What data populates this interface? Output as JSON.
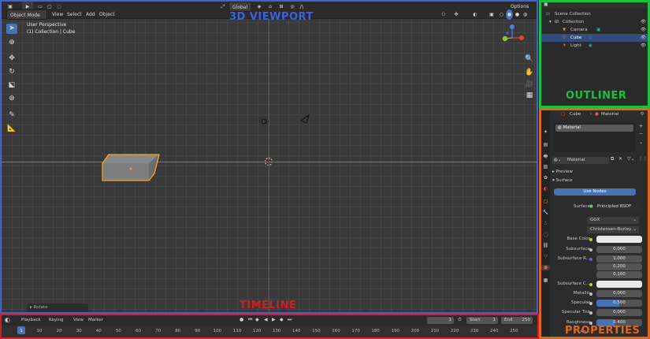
{
  "viewport": {
    "overlay_title": "3D VIEWPORT",
    "mode": "Object Mode",
    "menus": [
      "View",
      "Select",
      "Add",
      "Object"
    ],
    "orientation": "Global",
    "options_label": "Options",
    "perspective": "User Perspective",
    "context": "(1) Collection | Cube",
    "last_operator": "Rotate",
    "colors": {
      "x_axis": "#e2443d",
      "y_axis": "#8ac248",
      "z_axis": "#4a7fe0",
      "selection": "#f5a623"
    }
  },
  "outliner": {
    "overlay_title": "OUTLINER",
    "root": "Scene Collection",
    "items": [
      {
        "label": "Collection"
      },
      {
        "label": "Camera"
      },
      {
        "label": "Cube"
      },
      {
        "label": "Light"
      }
    ]
  },
  "properties": {
    "overlay_title": "PROPERTIES",
    "breadcrumb_object": "Cube",
    "breadcrumb_material": "Material",
    "slot_name": "Material",
    "material_name": "Material",
    "panels": {
      "preview": "Preview",
      "surface": "Surface"
    },
    "use_nodes": "Use Nodes",
    "surface_label": "Surface",
    "surface_value": "Principled BSDF",
    "distribution": "GGX",
    "subsurface_method": "Christensen-Burley",
    "fields": {
      "base_color": "Base Color",
      "subsurface": "Subsurface",
      "subsurface_value": "0.000",
      "subsurface_radius": "Subsurface R...",
      "radius_1": "1.000",
      "radius_2": "0.200",
      "radius_3": "0.100",
      "subsurface_color": "Subsurface C...",
      "metallic": "Metallic",
      "metallic_value": "0.000",
      "specular": "Specular",
      "specular_value": "0.500",
      "specular_tint": "Specular Tint",
      "specular_tint_value": "0.000",
      "roughness": "Roughness",
      "roughness_value": "0.400",
      "anisotropic": "An..."
    }
  },
  "timeline": {
    "overlay_title": "TIMELINE",
    "menus": [
      "Playback",
      "Keying",
      "View",
      "Marker"
    ],
    "current_frame": "1",
    "start_label": "Start",
    "start_value": "1",
    "end_label": "End",
    "end_value": "250",
    "ticks": [
      "1",
      "10",
      "20",
      "30",
      "40",
      "50",
      "60",
      "70",
      "80",
      "90",
      "100",
      "110",
      "120",
      "130",
      "140",
      "150",
      "160",
      "170",
      "180",
      "190",
      "200",
      "210",
      "220",
      "230",
      "240",
      "250"
    ]
  }
}
